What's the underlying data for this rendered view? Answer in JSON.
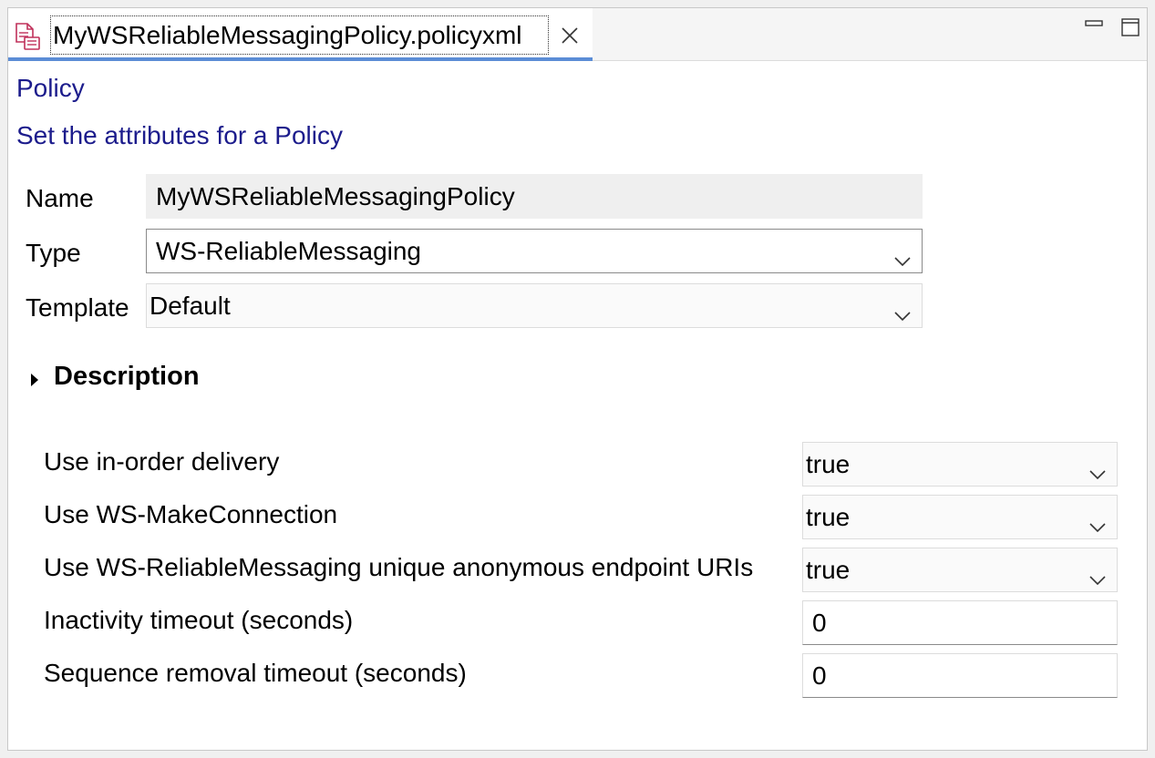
{
  "tab": {
    "title": "MyWSReliableMessagingPolicy.policyxml",
    "icon": "policy-file-icon",
    "icon_color": "#c0305a",
    "active_underline_color": "#5b8dd6"
  },
  "page": {
    "heading": "Policy",
    "subheading": "Set the attributes for a Policy",
    "heading_color": "#1c1c8c"
  },
  "form": {
    "name_label": "Name",
    "name_value": "MyWSReliableMessagingPolicy",
    "type_label": "Type",
    "type_value": "WS-ReliableMessaging",
    "template_label": "Template",
    "template_value": "Default"
  },
  "description": {
    "title": "Description",
    "expanded": false
  },
  "properties": [
    {
      "label": "Use in-order delivery",
      "value": "true",
      "kind": "select"
    },
    {
      "label": "Use WS-MakeConnection",
      "value": "true",
      "kind": "select"
    },
    {
      "label": "Use WS-ReliableMessaging unique anonymous endpoint URIs",
      "value": "true",
      "kind": "select"
    },
    {
      "label": "Inactivity timeout (seconds)",
      "value": "0",
      "kind": "text"
    },
    {
      "label": "Sequence removal timeout (seconds)",
      "value": "0",
      "kind": "text"
    }
  ]
}
